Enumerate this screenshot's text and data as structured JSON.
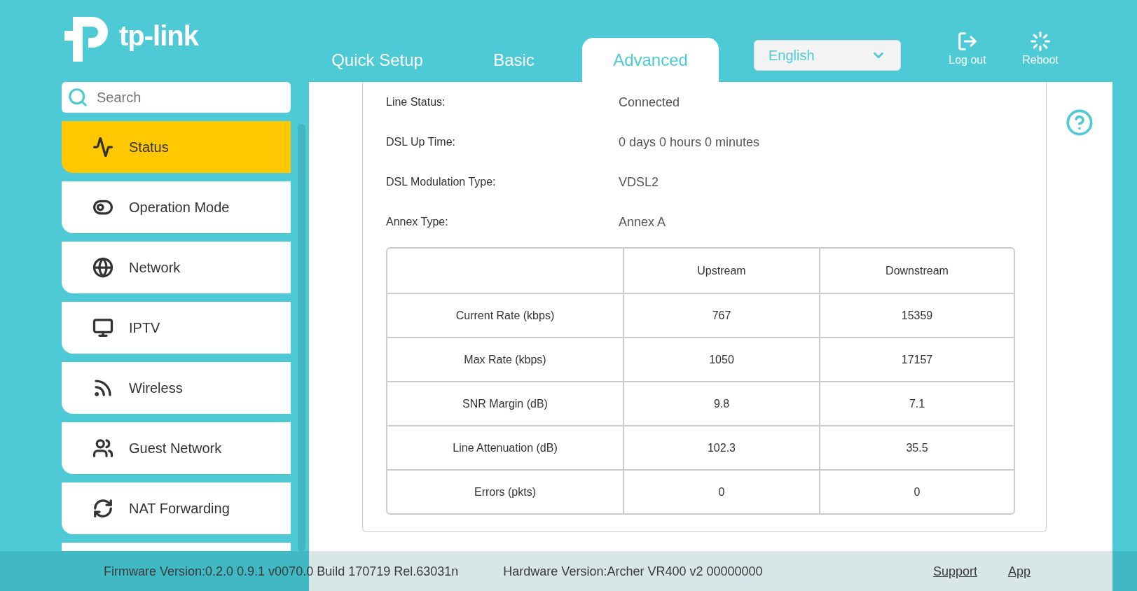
{
  "brand": {
    "name": "tp-link"
  },
  "tabs": [
    {
      "label": "Quick Setup",
      "selected": false
    },
    {
      "label": "Basic",
      "selected": false
    },
    {
      "label": "Advanced",
      "selected": true
    }
  ],
  "language": {
    "value": "English"
  },
  "actions": [
    {
      "kind": "logout",
      "label": "Log out"
    },
    {
      "kind": "reboot",
      "label": "Reboot"
    }
  ],
  "search": {
    "placeholder": "Search"
  },
  "sidebar": {
    "items": [
      {
        "kind": "status",
        "label": "Status",
        "selected": true
      },
      {
        "kind": "mode",
        "label": "Operation Mode",
        "selected": false
      },
      {
        "kind": "globe",
        "label": "Network",
        "selected": false
      },
      {
        "kind": "monitor",
        "label": "IPTV",
        "selected": false
      },
      {
        "kind": "wireless",
        "label": "Wireless",
        "selected": false
      },
      {
        "kind": "guest",
        "label": "Guest Network",
        "selected": false
      },
      {
        "kind": "nat",
        "label": "NAT Forwarding",
        "selected": false
      },
      {
        "kind": "blank",
        "selected": false
      }
    ]
  },
  "fields": [
    {
      "label": "Line Status:",
      "value": "Connected"
    },
    {
      "label": "DSL Up Time:",
      "value": "0 days 0 hours 0 minutes"
    },
    {
      "label": "DSL Modulation Type:",
      "value": "VDSL2"
    },
    {
      "label": "Annex Type:",
      "value": "Annex A"
    }
  ],
  "table": {
    "columns": [
      "Upstream",
      "Downstream"
    ],
    "rows": [
      {
        "label": "Current Rate (kbps)",
        "cells": [
          "767",
          "15359"
        ]
      },
      {
        "label": "Max Rate (kbps)",
        "cells": [
          "1050",
          "17157"
        ]
      },
      {
        "label": "SNR Margin (dB)",
        "cells": [
          "9.8",
          "7.1"
        ]
      },
      {
        "label": "Line Attenuation (dB)",
        "cells": [
          "102.3",
          "35.5"
        ]
      },
      {
        "label": "Errors (pkts)",
        "cells": [
          "0",
          "0"
        ]
      }
    ]
  },
  "status_bar": {
    "firmware": "Firmware Version:0.2.0 0.9.1 v0070.0 Build 170719 Rel.63031n",
    "hardware": "Hardware Version:Archer VR400 v2 00000000",
    "links": [
      "Support",
      "App"
    ]
  }
}
